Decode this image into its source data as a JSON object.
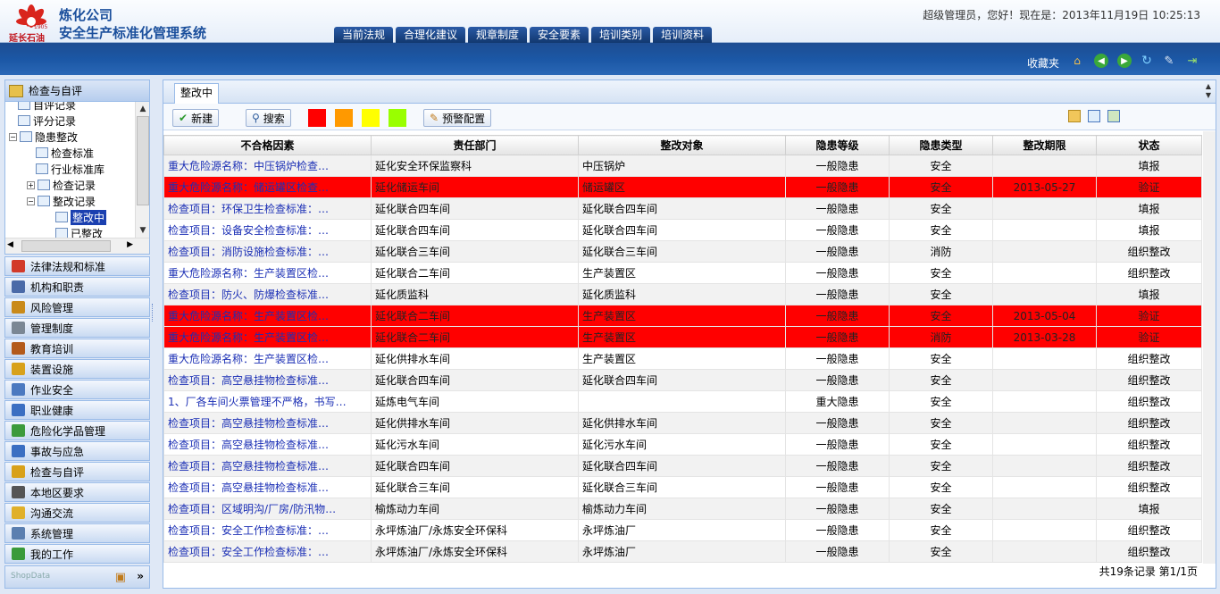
{
  "header": {
    "org_logo_text": "延长石油",
    "logo_year": "1905",
    "company": "炼化公司",
    "system_name": "安全生产标准化管理系统",
    "greeting": "超级管理员，您好！现在是：2013年11月19日  10:25:13"
  },
  "topnav": [
    "当前法规",
    "合理化建议",
    "规章制度",
    "安全要素",
    "培训类别",
    "培训资料"
  ],
  "band": {
    "favorites_label": "收藏夹",
    "icons": [
      "home-icon",
      "back-icon",
      "forward-icon",
      "refresh-icon",
      "tools-icon",
      "exit-icon"
    ]
  },
  "tree": {
    "header_label": "检查与自评",
    "nodes": [
      {
        "label": "自评记录",
        "indent": 1
      },
      {
        "label": "评分记录",
        "indent": 1
      },
      {
        "label": "隐患整改",
        "indent": 0
      },
      {
        "label": "检查标准",
        "indent": 2
      },
      {
        "label": "行业标准库",
        "indent": 2
      },
      {
        "label": "检查记录",
        "indent": 2
      },
      {
        "label": "整改记录",
        "indent": 2
      },
      {
        "label": "整改中",
        "indent": 3
      },
      {
        "label": "已整改",
        "indent": 3
      }
    ]
  },
  "menu": [
    {
      "label": "法律法规和标准",
      "icon": "law-icon",
      "color": "#d23a2a"
    },
    {
      "label": "机构和职责",
      "icon": "org-chart-icon",
      "color": "#4a6aa8"
    },
    {
      "label": "风险管理",
      "icon": "risk-icon",
      "color": "#c98a1a"
    },
    {
      "label": "管理制度",
      "icon": "document-icon",
      "color": "#7b8794"
    },
    {
      "label": "教育培训",
      "icon": "training-icon",
      "color": "#b35a1b"
    },
    {
      "label": "装置设施",
      "icon": "device-icon",
      "color": "#d8a11a"
    },
    {
      "label": "作业安全",
      "icon": "worker-icon",
      "color": "#4b79c0"
    },
    {
      "label": "职业健康",
      "icon": "info-icon",
      "color": "#3b6fc2"
    },
    {
      "label": "危险化学品管理",
      "icon": "chemical-icon",
      "color": "#3c9a3c"
    },
    {
      "label": "事故与应急",
      "icon": "emergency-icon",
      "color": "#3b6fc2"
    },
    {
      "label": "检查与自评",
      "icon": "checklist-icon",
      "color": "#d8a11a"
    },
    {
      "label": "本地区要求",
      "icon": "region-icon",
      "color": "#555555"
    },
    {
      "label": "沟通交流",
      "icon": "mail-icon",
      "color": "#e0b02a"
    },
    {
      "label": "系统管理",
      "icon": "settings-icon",
      "color": "#5b7fb0"
    },
    {
      "label": "我的工作",
      "icon": "worklist-icon",
      "color": "#3a9a3a"
    }
  ],
  "left_footer": {
    "watermark": "ShopData"
  },
  "content": {
    "active_tab": "整改中",
    "toolbar": {
      "new_label": "新建",
      "search_label": "搜索",
      "warning_config_label": "预警配置",
      "swatches": [
        "#ff0000",
        "#ff9900",
        "#ffff00",
        "#99ff00"
      ]
    },
    "columns": [
      "不合格因素",
      "责任部门",
      "整改对象",
      "隐患等级",
      "隐患类型",
      "整改期限",
      "状态"
    ],
    "rows": [
      {
        "factor": "重大危险源名称：中压锅炉检查…",
        "dept": "延化安全环保监察科",
        "target": "中压锅炉",
        "level": "一般隐患",
        "type": "安全",
        "deadline": "",
        "status": "填报",
        "alert": false
      },
      {
        "factor": "重大危险源名称：储运罐区检查…",
        "dept": "延化储运车间",
        "target": "储运罐区",
        "level": "一般隐患",
        "type": "安全",
        "deadline": "2013-05-27",
        "status": "验证",
        "alert": true
      },
      {
        "factor": "检查项目：环保卫生检查标准：…",
        "dept": "延化联合四车间",
        "target": "延化联合四车间",
        "level": "一般隐患",
        "type": "安全",
        "deadline": "",
        "status": "填报",
        "alert": false
      },
      {
        "factor": "检查项目：设备安全检查标准：…",
        "dept": "延化联合四车间",
        "target": "延化联合四车间",
        "level": "一般隐患",
        "type": "安全",
        "deadline": "",
        "status": "填报",
        "alert": false
      },
      {
        "factor": "检查项目：消防设施检查标准：…",
        "dept": "延化联合三车间",
        "target": "延化联合三车间",
        "level": "一般隐患",
        "type": "消防",
        "deadline": "",
        "status": "组织整改",
        "alert": false
      },
      {
        "factor": "重大危险源名称：生产装置区检…",
        "dept": "延化联合二车间",
        "target": "生产装置区",
        "level": "一般隐患",
        "type": "安全",
        "deadline": "",
        "status": "组织整改",
        "alert": false
      },
      {
        "factor": "检查项目：防火、防爆检查标准…",
        "dept": "延化质监科",
        "target": "延化质监科",
        "level": "一般隐患",
        "type": "安全",
        "deadline": "",
        "status": "填报",
        "alert": false
      },
      {
        "factor": "重大危险源名称：生产装置区检…",
        "dept": "延化联合二车间",
        "target": "生产装置区",
        "level": "一般隐患",
        "type": "安全",
        "deadline": "2013-05-04",
        "status": "验证",
        "alert": true
      },
      {
        "factor": "重大危险源名称：生产装置区检…",
        "dept": "延化联合二车间",
        "target": "生产装置区",
        "level": "一般隐患",
        "type": "消防",
        "deadline": "2013-03-28",
        "status": "验证",
        "alert": true
      },
      {
        "factor": "重大危险源名称：生产装置区检…",
        "dept": "延化供排水车间",
        "target": "生产装置区",
        "level": "一般隐患",
        "type": "安全",
        "deadline": "",
        "status": "组织整改",
        "alert": false
      },
      {
        "factor": "检查项目：高空悬挂物检查标准…",
        "dept": "延化联合四车间",
        "target": "延化联合四车间",
        "level": "一般隐患",
        "type": "安全",
        "deadline": "",
        "status": "组织整改",
        "alert": false
      },
      {
        "factor": "1、厂各车间火票管理不严格，书写…",
        "dept": "延炼电气车间",
        "target": "",
        "level": "重大隐患",
        "type": "安全",
        "deadline": "",
        "status": "组织整改",
        "alert": false
      },
      {
        "factor": "检查项目：高空悬挂物检查标准…",
        "dept": "延化供排水车间",
        "target": "延化供排水车间",
        "level": "一般隐患",
        "type": "安全",
        "deadline": "",
        "status": "组织整改",
        "alert": false
      },
      {
        "factor": "检查项目：高空悬挂物检查标准…",
        "dept": "延化污水车间",
        "target": "延化污水车间",
        "level": "一般隐患",
        "type": "安全",
        "deadline": "",
        "status": "组织整改",
        "alert": false
      },
      {
        "factor": "检查项目：高空悬挂物检查标准…",
        "dept": "延化联合四车间",
        "target": "延化联合四车间",
        "level": "一般隐患",
        "type": "安全",
        "deadline": "",
        "status": "组织整改",
        "alert": false
      },
      {
        "factor": "检查项目：高空悬挂物检查标准…",
        "dept": "延化联合三车间",
        "target": "延化联合三车间",
        "level": "一般隐患",
        "type": "安全",
        "deadline": "",
        "status": "组织整改",
        "alert": false
      },
      {
        "factor": "检查项目：区域明沟/厂房/防汛物…",
        "dept": "榆炼动力车间",
        "target": "榆炼动力车间",
        "level": "一般隐患",
        "type": "安全",
        "deadline": "",
        "status": "填报",
        "alert": false
      },
      {
        "factor": "检查项目：安全工作检查标准：…",
        "dept": "永坪炼油厂/永炼安全环保科",
        "target": "永坪炼油厂",
        "level": "一般隐患",
        "type": "安全",
        "deadline": "",
        "status": "组织整改",
        "alert": false
      },
      {
        "factor": "检查项目：安全工作检查标准：…",
        "dept": "永坪炼油厂/永炼安全环保科",
        "target": "永坪炼油厂",
        "level": "一般隐患",
        "type": "安全",
        "deadline": "",
        "status": "组织整改",
        "alert": false
      }
    ],
    "pager": "共19条记录 第1/1页"
  }
}
